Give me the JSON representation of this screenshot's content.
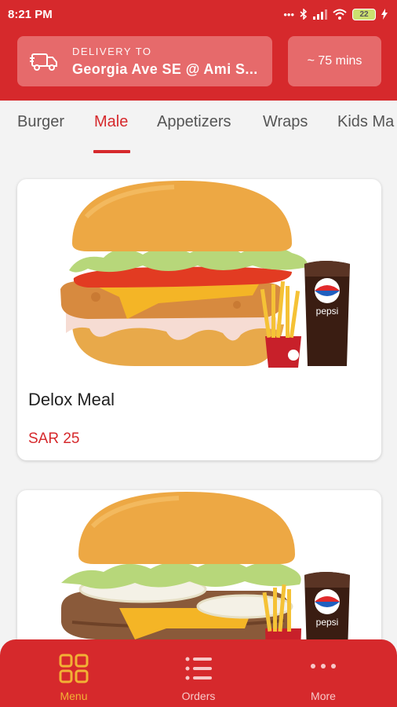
{
  "status_bar": {
    "time": "8:21 PM",
    "battery": "22"
  },
  "delivery": {
    "label": "DELIVERY TO",
    "address": "Georgia Ave SE @ Ami S..."
  },
  "eta": "~ 75 mins",
  "tabs": [
    {
      "label": "Burger",
      "active": false
    },
    {
      "label": "Male",
      "active": true
    },
    {
      "label": "Appetizers",
      "active": false
    },
    {
      "label": "Wraps",
      "active": false
    },
    {
      "label": "Kids Ma",
      "active": false
    }
  ],
  "items": [
    {
      "name": "Delox Meal",
      "price": "SAR 25"
    },
    {
      "name": "",
      "price": ""
    }
  ],
  "drink_brand": "pepsi",
  "bottom_nav": [
    {
      "label": "Menu",
      "icon": "grid-icon",
      "active": true
    },
    {
      "label": "Orders",
      "icon": "list-icon",
      "active": false
    },
    {
      "label": "More",
      "icon": "more-dots-icon",
      "active": false
    }
  ],
  "colors": {
    "brand": "#d6292c",
    "active_nav": "#f2b135",
    "card_accent": "#e66a6b"
  }
}
